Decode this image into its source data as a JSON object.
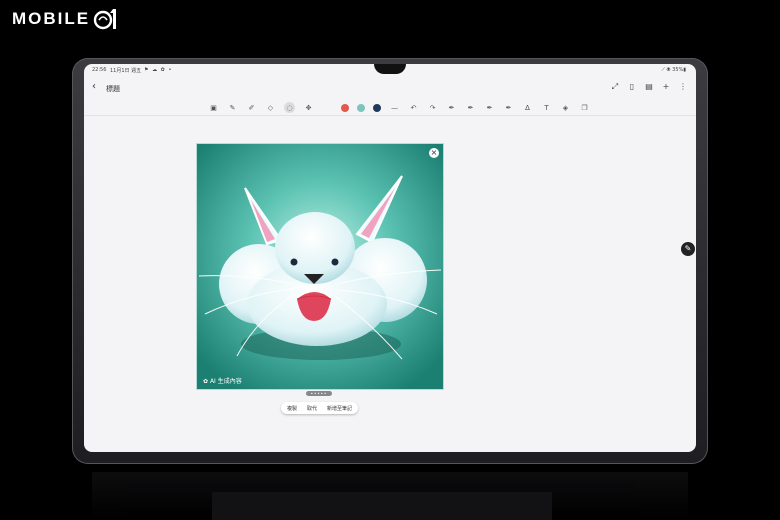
{
  "watermark": {
    "text": "MOBILE"
  },
  "status_bar": {
    "time": "22:56",
    "date": "11月1日 週五",
    "icons": "⚑ ☁ ✿ •",
    "battery": "⟋ ⦿ 35%▮"
  },
  "header": {
    "back_icon": "‹",
    "title": "標題",
    "icons": [
      "⤢",
      "▯",
      "▤",
      "+",
      "⋮"
    ]
  },
  "toolbar": {
    "tools": [
      {
        "name": "text-box-icon",
        "glyph": "▣"
      },
      {
        "name": "pen-icon",
        "glyph": "✎"
      },
      {
        "name": "highlighter-icon",
        "glyph": "✐"
      },
      {
        "name": "eraser-icon",
        "glyph": "◇"
      },
      {
        "name": "lasso-icon",
        "glyph": "◌",
        "selected": true
      },
      {
        "name": "touch-draw-icon",
        "glyph": "✥"
      }
    ],
    "colors": [
      "#e35a4a",
      "#7fc3bb",
      "#1e3a5a"
    ],
    "more_tools": [
      {
        "name": "stroke-size-icon",
        "glyph": "—"
      },
      {
        "name": "undo-icon",
        "glyph": "↶"
      },
      {
        "name": "redo-icon",
        "glyph": "↷"
      },
      {
        "name": "pen-style-1-icon",
        "glyph": "✒"
      },
      {
        "name": "pen-style-2-icon",
        "glyph": "✒"
      },
      {
        "name": "pen-style-3-icon",
        "glyph": "✒"
      },
      {
        "name": "red-pen-icon",
        "glyph": "✒"
      },
      {
        "name": "blue-highlighter-icon",
        "glyph": "∆"
      },
      {
        "name": "text-recognize-icon",
        "glyph": "T"
      },
      {
        "name": "shape-icon",
        "glyph": "◈"
      },
      {
        "name": "copy-format-icon",
        "glyph": "❐"
      }
    ]
  },
  "ai_image": {
    "close_icon": "×",
    "label": "AI 生成內容",
    "label_icon": "✿"
  },
  "selection_menu": {
    "handle": "•••••",
    "items": [
      "複製",
      "取代",
      "新增至筆記"
    ]
  },
  "fab": {
    "icon": "✎"
  },
  "colors": {
    "screen_bg": "#f4f4f6",
    "image_bg": "#2a9a8a",
    "accent": "#e0455e"
  }
}
